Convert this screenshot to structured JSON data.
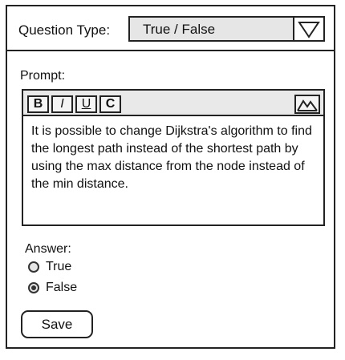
{
  "header": {
    "question_type_label": "Question Type:",
    "question_type_value": "True / False",
    "dropdown_icon": "triangle-down-icon"
  },
  "prompt": {
    "label": "Prompt:",
    "toolbar": {
      "bold": "B",
      "italic": "I",
      "underline": "U",
      "code": "C",
      "image_icon": "image-icon"
    },
    "text": "It is possible to change Dijkstra's algorithm to find the longest path instead of the shortest path by using the max distance from the node instead of the min distance."
  },
  "answer": {
    "label": "Answer:",
    "options": [
      {
        "label": "True",
        "selected": false
      },
      {
        "label": "False",
        "selected": true
      }
    ]
  },
  "actions": {
    "save_label": "Save"
  }
}
